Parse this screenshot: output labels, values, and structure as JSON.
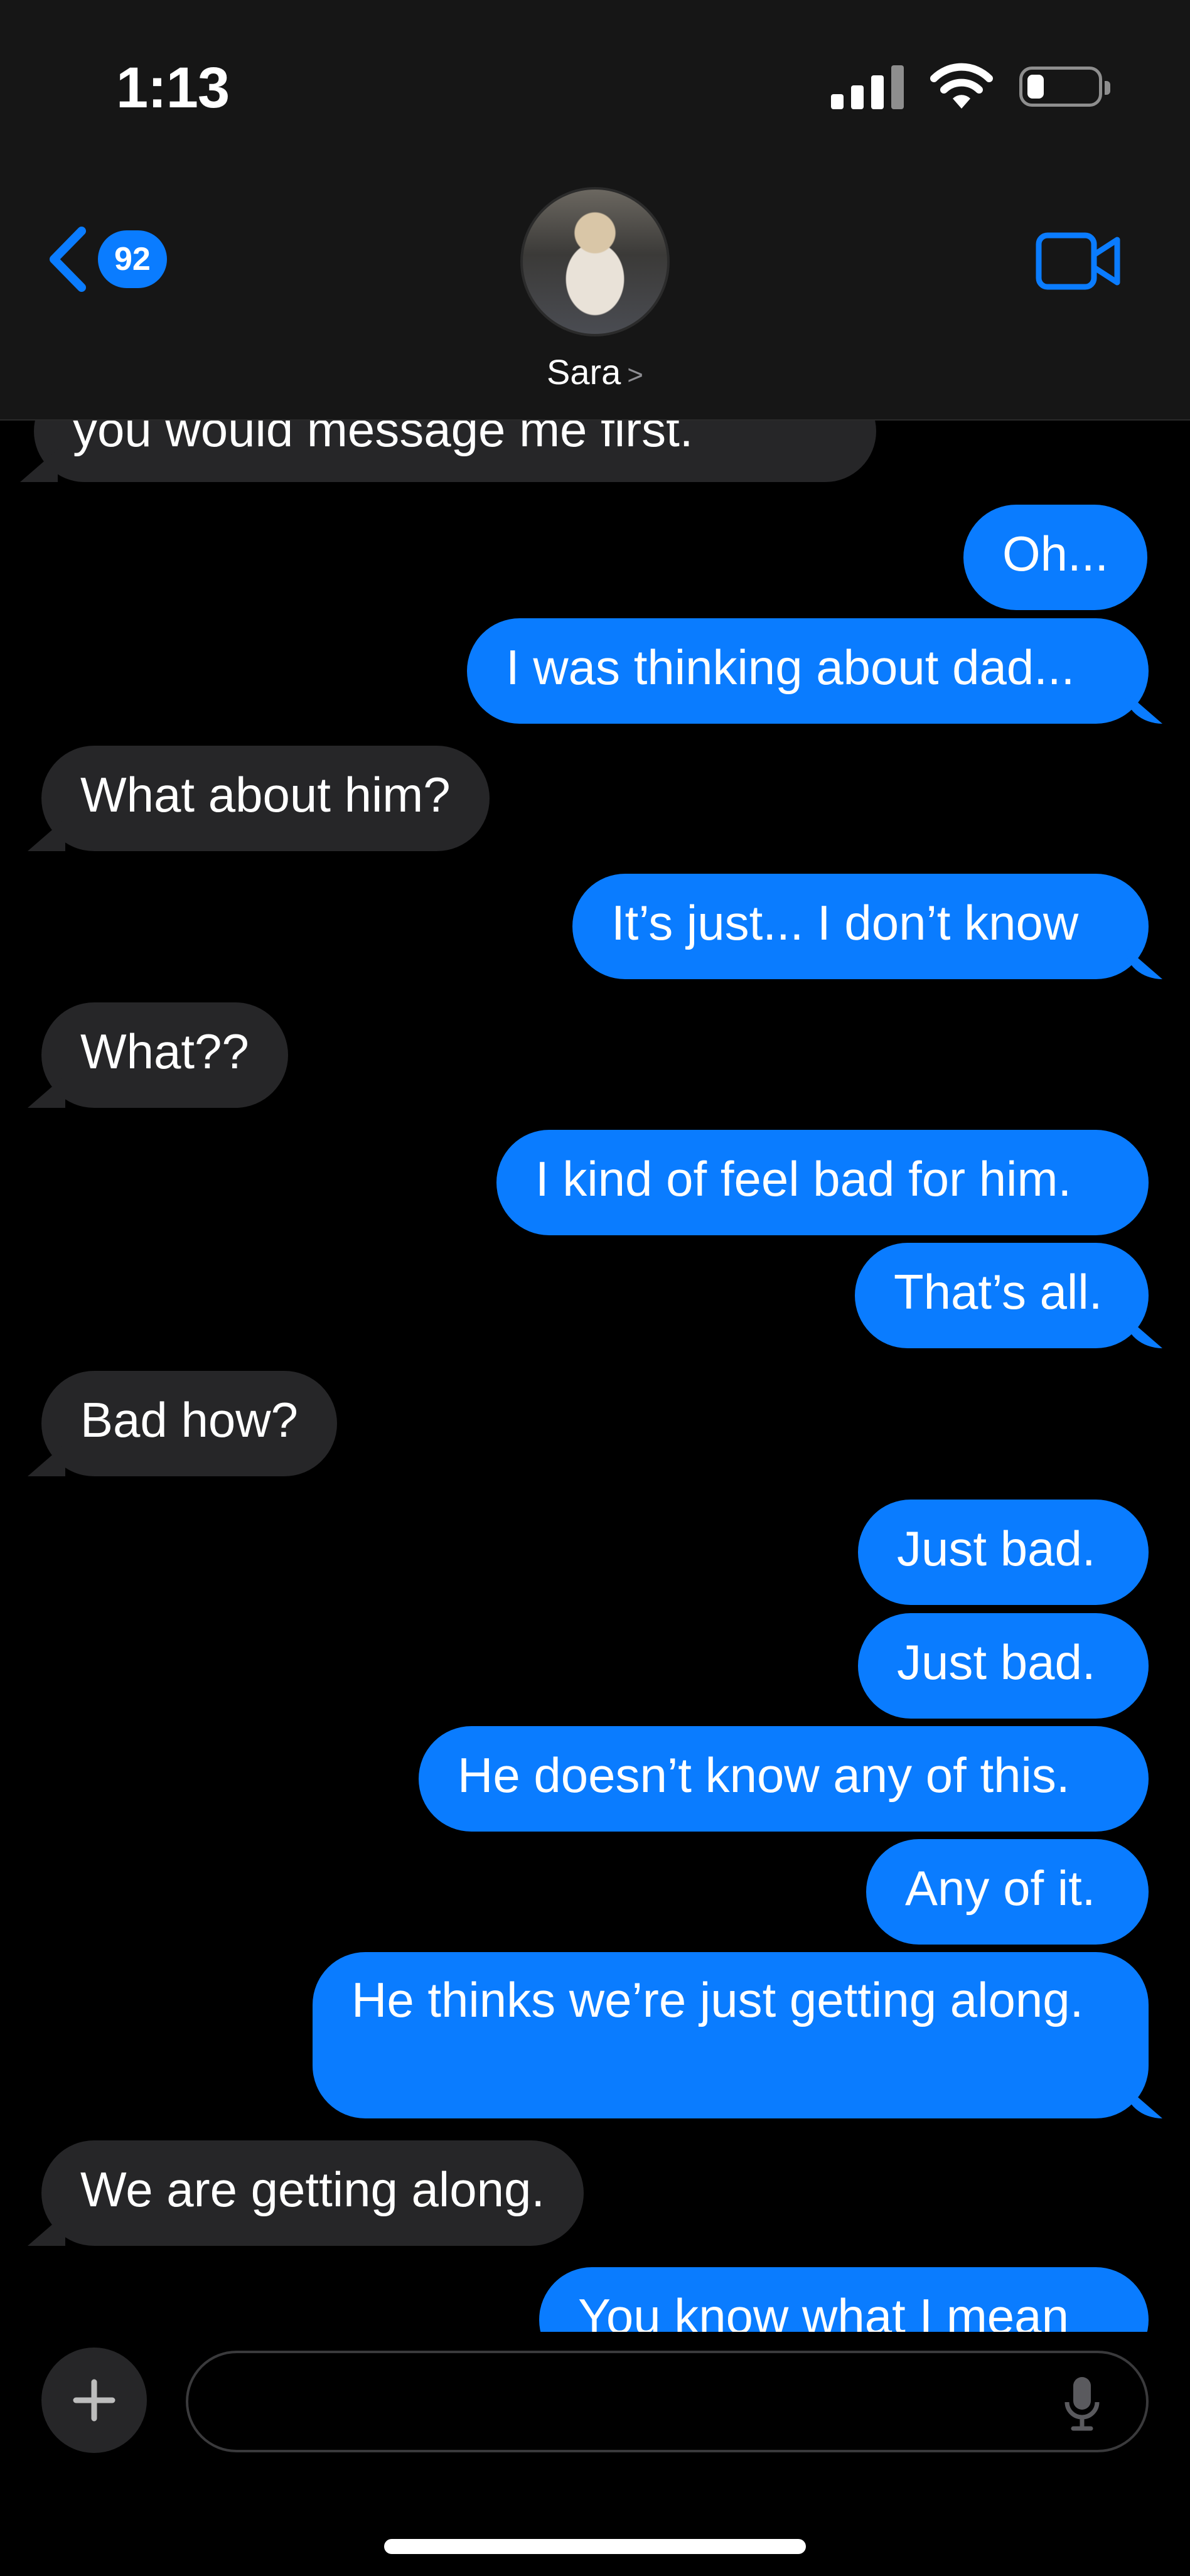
{
  "status_bar": {
    "time": "1:13"
  },
  "header": {
    "back_count": "92",
    "contact_name": "Sara",
    "contact_chevron": ">"
  },
  "messages": [
    {
      "dir": "in",
      "text": "you would message me first."
    },
    {
      "dir": "out",
      "text": "Oh..."
    },
    {
      "dir": "out",
      "text": "I was thinking about dad..."
    },
    {
      "dir": "in",
      "text": "What about him?"
    },
    {
      "dir": "out",
      "text": "It’s just... I don’t know"
    },
    {
      "dir": "in",
      "text": "What??"
    },
    {
      "dir": "out",
      "text": "I kind of feel bad for him."
    },
    {
      "dir": "out",
      "text": "That’s all."
    },
    {
      "dir": "in",
      "text": "Bad how?"
    },
    {
      "dir": "out",
      "text": "Just bad."
    },
    {
      "dir": "out",
      "text": "Just bad."
    },
    {
      "dir": "out",
      "text": "He doesn’t know any of this."
    },
    {
      "dir": "out",
      "text": "Any of it."
    },
    {
      "dir": "out",
      "text": "He thinks we’re just getting along."
    },
    {
      "dir": "in",
      "text": "We are getting along."
    },
    {
      "dir": "out",
      "text": "You know what I mean"
    }
  ],
  "composer": {
    "placeholder": ""
  },
  "colors": {
    "outgoing": "#0a7cff",
    "incoming": "#262628",
    "accent": "#0a7cff"
  },
  "icons": [
    "back-chevron-icon",
    "video-call-icon",
    "plus-icon",
    "microphone-icon",
    "cellular-signal-icon",
    "wifi-icon",
    "battery-icon"
  ]
}
